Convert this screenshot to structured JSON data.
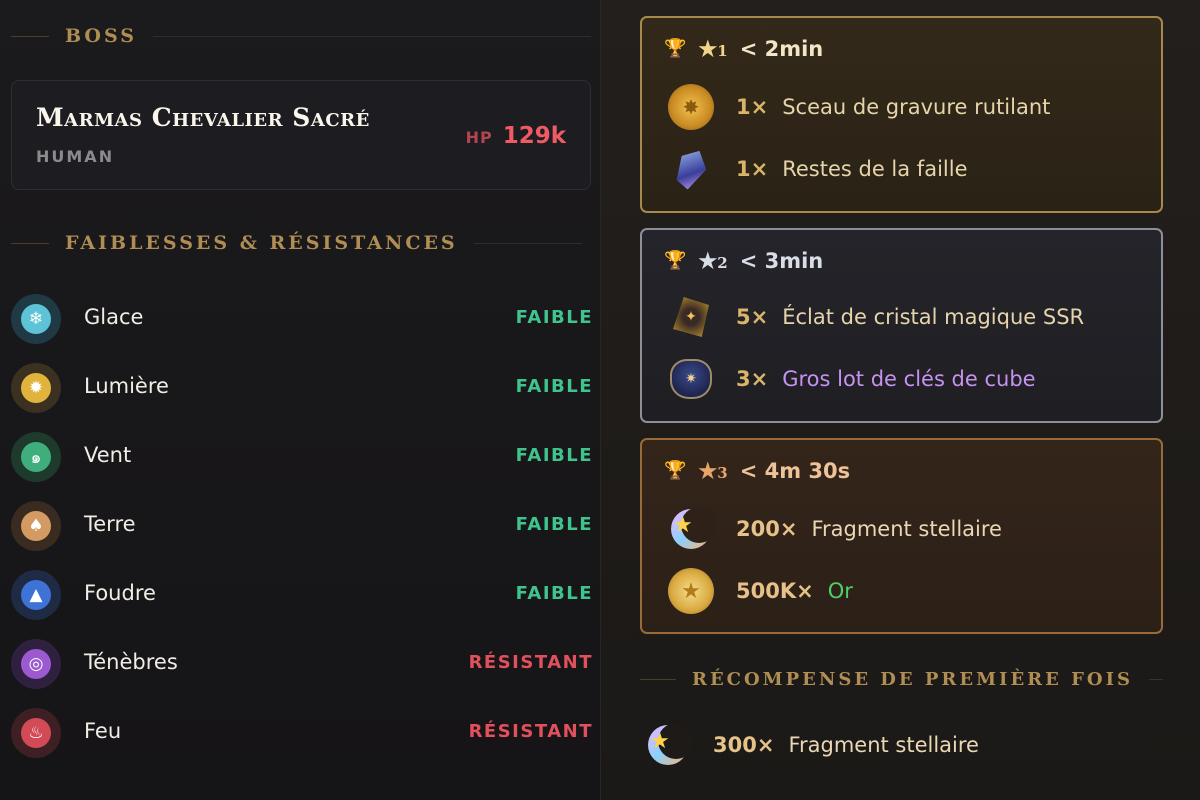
{
  "left": {
    "boss_section_title": "BOSS",
    "boss": {
      "name": "Marmas Chevalier Sacré",
      "type": "HUMAN",
      "hp_label": "HP",
      "hp_value": "129k"
    },
    "elements_section_title": "FAIBLESSES & RÉSISTANCES",
    "elements": [
      {
        "name": "Glace",
        "status": "FAIBLE",
        "icon": "snowflake-icon",
        "color": "#5fc3d8"
      },
      {
        "name": "Lumière",
        "status": "FAIBLE",
        "icon": "sun-icon",
        "color": "#e0b33c"
      },
      {
        "name": "Vent",
        "status": "FAIBLE",
        "icon": "wind-icon",
        "color": "#3fae7c"
      },
      {
        "name": "Terre",
        "status": "FAIBLE",
        "icon": "earth-icon",
        "color": "#d49a63"
      },
      {
        "name": "Foudre",
        "status": "FAIBLE",
        "icon": "lightning-icon",
        "color": "#3e72d6"
      },
      {
        "name": "Ténèbres",
        "status": "RÉSISTANT",
        "icon": "darkness-icon",
        "color": "#9c5ad0"
      },
      {
        "name": "Feu",
        "status": "RÉSISTANT",
        "icon": "fire-icon",
        "color": "#d24a55"
      }
    ]
  },
  "right": {
    "tiers": [
      {
        "stars": "★",
        "star_num": "1",
        "time": "< 2min",
        "accent": "#c9a652",
        "rewards": [
          {
            "qty": "1×",
            "name": "Sceau de gravure rutilant",
            "icon": "gold-seal-icon"
          },
          {
            "qty": "1×",
            "name": "Restes de la faille",
            "icon": "crystal-shard-icon"
          }
        ]
      },
      {
        "stars": "★",
        "star_num": "2",
        "time": "< 3min",
        "accent": "#9aa0a8",
        "rewards": [
          {
            "qty": "5×",
            "name": "Éclat de cristal magique SSR",
            "icon": "magic-crystal-icon"
          },
          {
            "qty": "3×",
            "name": "Gros lot de clés de cube",
            "icon": "key-bag-icon"
          }
        ]
      },
      {
        "stars": "★",
        "star_num": "3",
        "time": "< 4m 30s",
        "accent": "#c98752",
        "rewards": [
          {
            "qty": "200×",
            "name": "Fragment stellaire",
            "icon": "star-moon-icon"
          },
          {
            "qty": "500K×",
            "name": "Or",
            "icon": "gold-coin-icon"
          }
        ]
      }
    ],
    "first_time_title": "RÉCOMPENSE DE PREMIÈRE FOIS",
    "first_time_reward": {
      "qty": "300×",
      "name": "Fragment stellaire",
      "icon": "star-moon-icon"
    }
  }
}
